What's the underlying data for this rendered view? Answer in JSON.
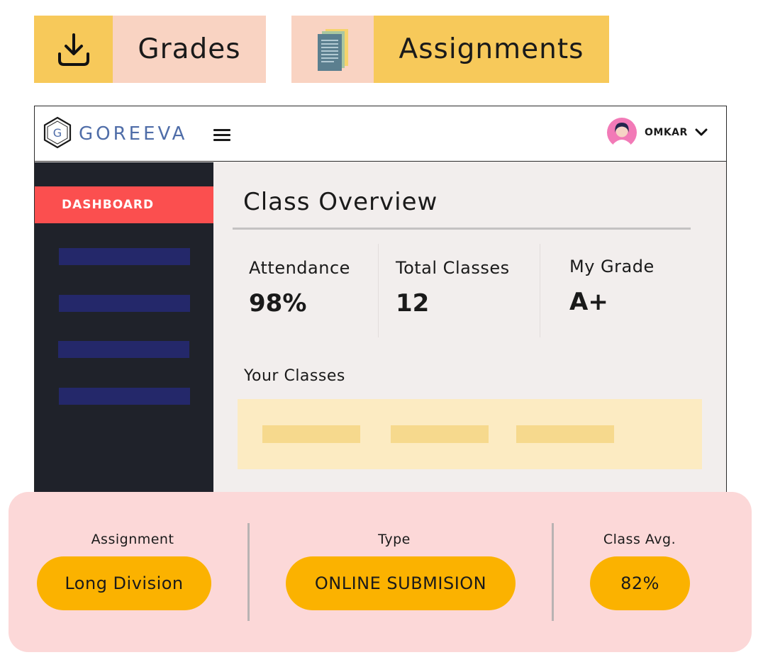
{
  "cards": {
    "grades_label": "Grades",
    "assignments_label": "Assignments"
  },
  "app": {
    "brand": "GOREEVA",
    "brand_letter": "G",
    "user_name": "OMKAR",
    "sidebar": {
      "active_item": "DASHBOARD"
    },
    "main": {
      "title": "Class Overview",
      "stats": [
        {
          "label": "Attendance",
          "value": "98%"
        },
        {
          "label": "Total Classes",
          "value": "12"
        },
        {
          "label": "My Grade",
          "value": "A+"
        }
      ],
      "your_classes_label": "Your Classes"
    }
  },
  "assignment_panel": {
    "assignment_label": "Assignment",
    "assignment_value": "Long Division",
    "type_label": "Type",
    "type_value": "ONLINE SUBMISION",
    "avg_label": "Class Avg.",
    "avg_value": "82%"
  },
  "colors": {
    "accent_yellow": "#f7c95a",
    "accent_peach": "#f9d3c2",
    "sidebar_bg": "#1f222a",
    "dashboard_red": "#fb4f4f",
    "brand_blue": "#4f6da8",
    "pill_orange": "#fbb200",
    "panel_pink": "#fcd8d8"
  },
  "icons": {
    "grades": "download-icon",
    "assignments": "document-stack-icon",
    "menu": "hamburger-menu-icon",
    "user": "avatar",
    "dropdown": "chevron-down-icon",
    "logo": "hexagon-logo-icon"
  }
}
